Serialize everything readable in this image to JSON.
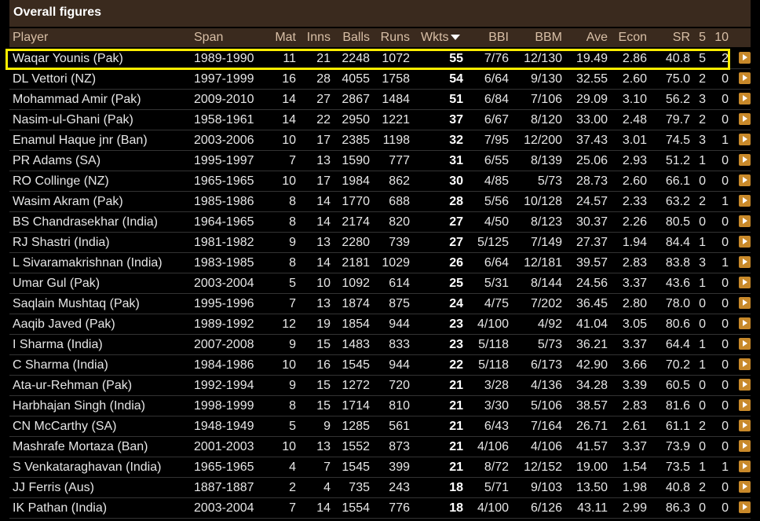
{
  "title": "Overall figures",
  "colors": {
    "header_bg": "#3a2a1e",
    "header_text": "#d8bfa6",
    "highlight": "#ffee00",
    "arrow_button": "#c8892a"
  },
  "columns": [
    "Player",
    "Span",
    "Mat",
    "Inns",
    "Balls",
    "Runs",
    "Wkts",
    "BBI",
    "BBM",
    "Ave",
    "Econ",
    "SR",
    "5",
    "10"
  ],
  "sorted_column": "Wkts",
  "highlighted_row": 0,
  "rows": [
    {
      "player": "Waqar Younis (Pak)",
      "span": "1989-1990",
      "mat": "11",
      "inns": "21",
      "balls": "2248",
      "runs": "1072",
      "wkts": "55",
      "bbi": "7/76",
      "bbm": "12/130",
      "ave": "19.49",
      "econ": "2.86",
      "sr": "40.8",
      "five": "5",
      "ten": "2"
    },
    {
      "player": "DL Vettori (NZ)",
      "span": "1997-1999",
      "mat": "16",
      "inns": "28",
      "balls": "4055",
      "runs": "1758",
      "wkts": "54",
      "bbi": "6/64",
      "bbm": "9/130",
      "ave": "32.55",
      "econ": "2.60",
      "sr": "75.0",
      "five": "2",
      "ten": "0"
    },
    {
      "player": "Mohammad Amir (Pak)",
      "span": "2009-2010",
      "mat": "14",
      "inns": "27",
      "balls": "2867",
      "runs": "1484",
      "wkts": "51",
      "bbi": "6/84",
      "bbm": "7/106",
      "ave": "29.09",
      "econ": "3.10",
      "sr": "56.2",
      "five": "3",
      "ten": "0"
    },
    {
      "player": "Nasim-ul-Ghani (Pak)",
      "span": "1958-1961",
      "mat": "14",
      "inns": "22",
      "balls": "2950",
      "runs": "1221",
      "wkts": "37",
      "bbi": "6/67",
      "bbm": "8/120",
      "ave": "33.00",
      "econ": "2.48",
      "sr": "79.7",
      "five": "2",
      "ten": "0"
    },
    {
      "player": "Enamul Haque jnr (Ban)",
      "span": "2003-2006",
      "mat": "10",
      "inns": "17",
      "balls": "2385",
      "runs": "1198",
      "wkts": "32",
      "bbi": "7/95",
      "bbm": "12/200",
      "ave": "37.43",
      "econ": "3.01",
      "sr": "74.5",
      "five": "3",
      "ten": "1"
    },
    {
      "player": "PR Adams (SA)",
      "span": "1995-1997",
      "mat": "7",
      "inns": "13",
      "balls": "1590",
      "runs": "777",
      "wkts": "31",
      "bbi": "6/55",
      "bbm": "8/139",
      "ave": "25.06",
      "econ": "2.93",
      "sr": "51.2",
      "five": "1",
      "ten": "0"
    },
    {
      "player": "RO Collinge (NZ)",
      "span": "1965-1965",
      "mat": "10",
      "inns": "17",
      "balls": "1984",
      "runs": "862",
      "wkts": "30",
      "bbi": "4/85",
      "bbm": "5/73",
      "ave": "28.73",
      "econ": "2.60",
      "sr": "66.1",
      "five": "0",
      "ten": "0"
    },
    {
      "player": "Wasim Akram (Pak)",
      "span": "1985-1986",
      "mat": "8",
      "inns": "14",
      "balls": "1770",
      "runs": "688",
      "wkts": "28",
      "bbi": "5/56",
      "bbm": "10/128",
      "ave": "24.57",
      "econ": "2.33",
      "sr": "63.2",
      "five": "2",
      "ten": "1"
    },
    {
      "player": "BS Chandrasekhar (India)",
      "span": "1964-1965",
      "mat": "8",
      "inns": "14",
      "balls": "2174",
      "runs": "820",
      "wkts": "27",
      "bbi": "4/50",
      "bbm": "8/123",
      "ave": "30.37",
      "econ": "2.26",
      "sr": "80.5",
      "five": "0",
      "ten": "0"
    },
    {
      "player": "RJ Shastri (India)",
      "span": "1981-1982",
      "mat": "9",
      "inns": "13",
      "balls": "2280",
      "runs": "739",
      "wkts": "27",
      "bbi": "5/125",
      "bbm": "7/149",
      "ave": "27.37",
      "econ": "1.94",
      "sr": "84.4",
      "five": "1",
      "ten": "0"
    },
    {
      "player": "L Sivaramakrishnan (India)",
      "span": "1983-1985",
      "mat": "8",
      "inns": "14",
      "balls": "2181",
      "runs": "1029",
      "wkts": "26",
      "bbi": "6/64",
      "bbm": "12/181",
      "ave": "39.57",
      "econ": "2.83",
      "sr": "83.8",
      "five": "3",
      "ten": "1"
    },
    {
      "player": "Umar Gul (Pak)",
      "span": "2003-2004",
      "mat": "5",
      "inns": "10",
      "balls": "1092",
      "runs": "614",
      "wkts": "25",
      "bbi": "5/31",
      "bbm": "8/144",
      "ave": "24.56",
      "econ": "3.37",
      "sr": "43.6",
      "five": "1",
      "ten": "0"
    },
    {
      "player": "Saqlain Mushtaq (Pak)",
      "span": "1995-1996",
      "mat": "7",
      "inns": "13",
      "balls": "1874",
      "runs": "875",
      "wkts": "24",
      "bbi": "4/75",
      "bbm": "7/202",
      "ave": "36.45",
      "econ": "2.80",
      "sr": "78.0",
      "five": "0",
      "ten": "0"
    },
    {
      "player": "Aaqib Javed (Pak)",
      "span": "1989-1992",
      "mat": "12",
      "inns": "19",
      "balls": "1854",
      "runs": "944",
      "wkts": "23",
      "bbi": "4/100",
      "bbm": "4/92",
      "ave": "41.04",
      "econ": "3.05",
      "sr": "80.6",
      "five": "0",
      "ten": "0"
    },
    {
      "player": "I Sharma (India)",
      "span": "2007-2008",
      "mat": "9",
      "inns": "15",
      "balls": "1483",
      "runs": "833",
      "wkts": "23",
      "bbi": "5/118",
      "bbm": "5/73",
      "ave": "36.21",
      "econ": "3.37",
      "sr": "64.4",
      "five": "1",
      "ten": "0"
    },
    {
      "player": "C Sharma (India)",
      "span": "1984-1986",
      "mat": "10",
      "inns": "16",
      "balls": "1545",
      "runs": "944",
      "wkts": "22",
      "bbi": "5/118",
      "bbm": "6/173",
      "ave": "42.90",
      "econ": "3.66",
      "sr": "70.2",
      "five": "1",
      "ten": "0"
    },
    {
      "player": "Ata-ur-Rehman (Pak)",
      "span": "1992-1994",
      "mat": "9",
      "inns": "15",
      "balls": "1272",
      "runs": "720",
      "wkts": "21",
      "bbi": "3/28",
      "bbm": "4/136",
      "ave": "34.28",
      "econ": "3.39",
      "sr": "60.5",
      "five": "0",
      "ten": "0"
    },
    {
      "player": "Harbhajan Singh (India)",
      "span": "1998-1999",
      "mat": "8",
      "inns": "15",
      "balls": "1714",
      "runs": "810",
      "wkts": "21",
      "bbi": "3/30",
      "bbm": "5/106",
      "ave": "38.57",
      "econ": "2.83",
      "sr": "81.6",
      "five": "0",
      "ten": "0"
    },
    {
      "player": "CN McCarthy (SA)",
      "span": "1948-1949",
      "mat": "5",
      "inns": "9",
      "balls": "1285",
      "runs": "561",
      "wkts": "21",
      "bbi": "6/43",
      "bbm": "7/164",
      "ave": "26.71",
      "econ": "2.61",
      "sr": "61.1",
      "five": "2",
      "ten": "0"
    },
    {
      "player": "Mashrafe Mortaza (Ban)",
      "span": "2001-2003",
      "mat": "10",
      "inns": "13",
      "balls": "1552",
      "runs": "873",
      "wkts": "21",
      "bbi": "4/106",
      "bbm": "4/106",
      "ave": "41.57",
      "econ": "3.37",
      "sr": "73.9",
      "five": "0",
      "ten": "0"
    },
    {
      "player": "S Venkataraghavan (India)",
      "span": "1965-1965",
      "mat": "4",
      "inns": "7",
      "balls": "1545",
      "runs": "399",
      "wkts": "21",
      "bbi": "8/72",
      "bbm": "12/152",
      "ave": "19.00",
      "econ": "1.54",
      "sr": "73.5",
      "five": "1",
      "ten": "1"
    },
    {
      "player": "JJ Ferris (Aus)",
      "span": "1887-1887",
      "mat": "2",
      "inns": "4",
      "balls": "735",
      "runs": "243",
      "wkts": "18",
      "bbi": "5/71",
      "bbm": "9/103",
      "ave": "13.50",
      "econ": "1.98",
      "sr": "40.8",
      "five": "2",
      "ten": "0"
    },
    {
      "player": "IK Pathan (India)",
      "span": "2003-2004",
      "mat": "7",
      "inns": "14",
      "balls": "1554",
      "runs": "776",
      "wkts": "18",
      "bbi": "4/100",
      "bbm": "6/126",
      "ave": "43.11",
      "econ": "2.99",
      "sr": "86.3",
      "five": "0",
      "ten": "0"
    }
  ]
}
